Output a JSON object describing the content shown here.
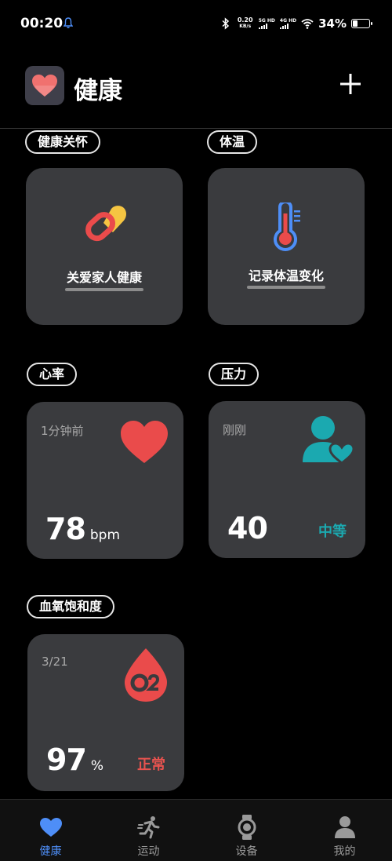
{
  "status_bar": {
    "time": "00:20",
    "speed_value": "0.20",
    "speed_unit": "KB/s",
    "net1": "5G HD",
    "net2": "4G HD",
    "battery_percent": "34%",
    "battery_level": 0.34
  },
  "header": {
    "title": "健康"
  },
  "sections": {
    "care": {
      "label": "健康关怀",
      "card_label": "关爱家人健康"
    },
    "temperature": {
      "label": "体温",
      "card_label": "记录体温变化"
    },
    "heart_rate": {
      "label": "心率",
      "time": "1分钟前",
      "value": "78",
      "unit": "bpm"
    },
    "stress": {
      "label": "压力",
      "time": "刚刚",
      "value": "40",
      "status": "中等"
    },
    "spo2": {
      "label": "血氧饱和度",
      "time": "3/21",
      "value": "97",
      "unit": "%",
      "status": "正常"
    }
  },
  "nav": {
    "items": [
      {
        "label": "健康",
        "icon": "heart-icon",
        "active": true
      },
      {
        "label": "运动",
        "icon": "running-icon",
        "active": false
      },
      {
        "label": "设备",
        "icon": "watch-icon",
        "active": false
      },
      {
        "label": "我的",
        "icon": "person-icon",
        "active": false
      }
    ]
  },
  "colors": {
    "accent_blue": "#4e8ef7",
    "heart_red": "#ea4b4b",
    "teal": "#1ba9b0",
    "card_bg": "#3a3b3e",
    "status_red": "#e8534f"
  }
}
